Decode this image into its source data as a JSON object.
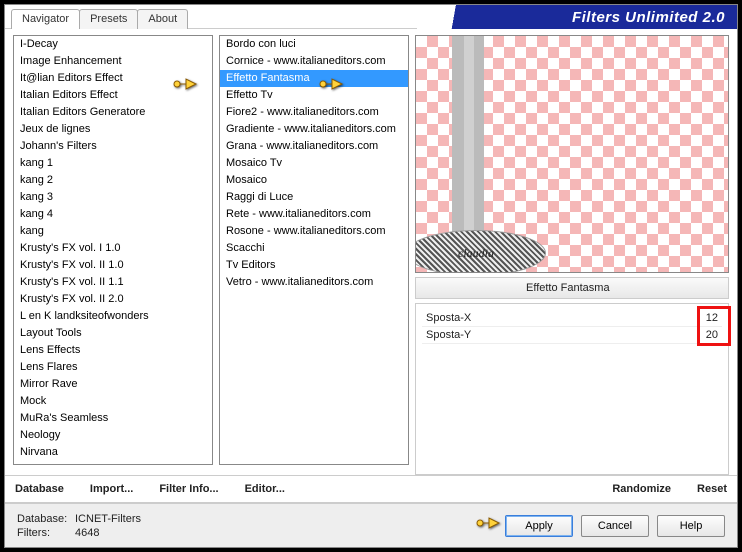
{
  "title": "Filters Unlimited 2.0",
  "tabs": [
    {
      "label": "Navigator",
      "active": true
    },
    {
      "label": "Presets",
      "active": false
    },
    {
      "label": "About",
      "active": false
    }
  ],
  "categories": [
    "I-Decay",
    "Image Enhancement",
    "It@lian Editors Effect",
    "Italian Editors Effect",
    "Italian Editors Generatore",
    "Jeux de lignes",
    "Johann's Filters",
    "kang 1",
    "kang 2",
    "kang 3",
    "kang 4",
    "kang",
    "Krusty's FX vol. I 1.0",
    "Krusty's FX vol. II 1.0",
    "Krusty's FX vol. II 1.1",
    "Krusty's FX vol. II 2.0",
    "L en K landksiteofwonders",
    "Layout Tools",
    "Lens Effects",
    "Lens Flares",
    "Mirror Rave",
    "Mock",
    "MuRa's Seamless",
    "Neology",
    "Nirvana"
  ],
  "categories_pointer_index": 2,
  "filters": [
    "Bordo con luci",
    "Cornice - www.italianeditors.com",
    "Effetto Fantasma",
    "Effetto Tv",
    "Fiore2 - www.italianeditors.com",
    "Gradiente - www.italianeditors.com",
    "Grana - www.italianeditors.com",
    "Mosaico Tv",
    "Mosaico",
    "Raggi di Luce",
    "Rete - www.italianeditors.com",
    "Rosone - www.italianeditors.com",
    "Scacchi",
    "Tv Editors",
    "Vetro - www.italianeditors.com"
  ],
  "filters_selected_index": 2,
  "watermark_text": "claudia",
  "effect_name": "Effetto Fantasma",
  "params": [
    {
      "name": "Sposta-X",
      "value": "12"
    },
    {
      "name": "Sposta-Y",
      "value": "20"
    }
  ],
  "midbar": {
    "database": "Database",
    "import": "Import...",
    "filter_info": "Filter Info...",
    "editor": "Editor...",
    "randomize": "Randomize",
    "reset": "Reset"
  },
  "footer": {
    "db_label": "Database:",
    "db_value": "ICNET-Filters",
    "filters_label": "Filters:",
    "filters_value": "4648",
    "apply": "Apply",
    "cancel": "Cancel",
    "help": "Help"
  }
}
